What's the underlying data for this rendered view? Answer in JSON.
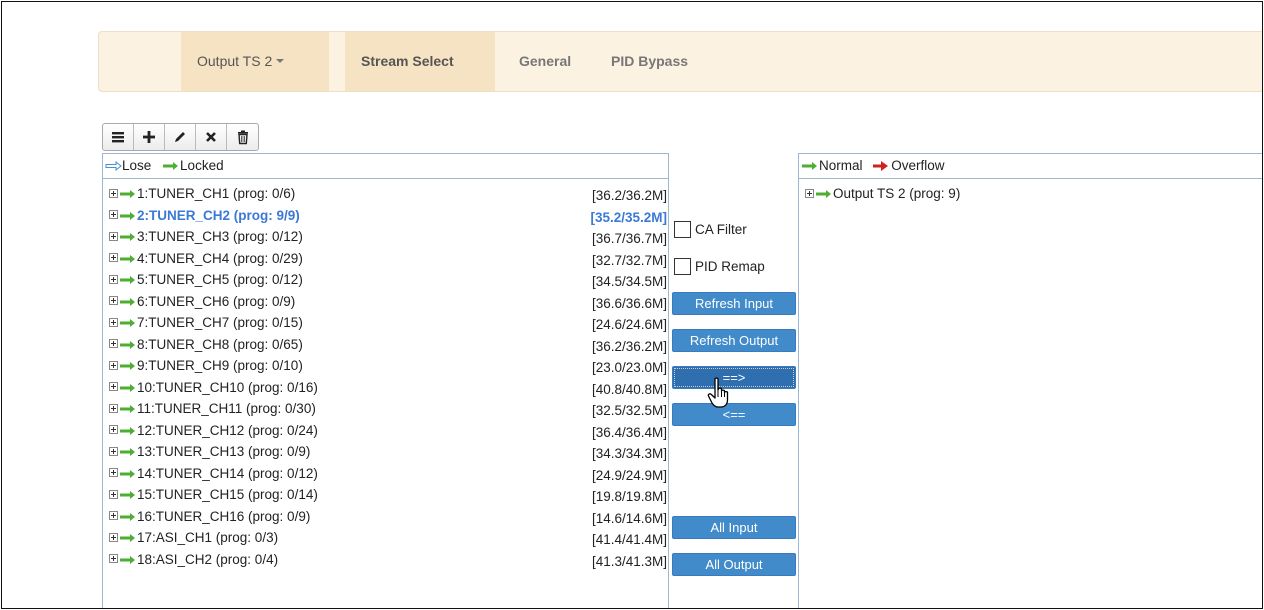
{
  "tabs": {
    "output_ts": "Output TS 2",
    "stream_select": "Stream Select",
    "general": "General",
    "pid_bypass": "PID Bypass"
  },
  "toolbar": {
    "icons": [
      "list-icon",
      "plus-icon",
      "pencil-icon",
      "close-icon",
      "trash-icon"
    ]
  },
  "input_panel": {
    "legend_lose": "Lose",
    "legend_locked": "Locked",
    "rows": [
      {
        "label": "1:TUNER_CH1 (prog: 0/6)",
        "rate": "[36.2/36.2M]"
      },
      {
        "label": "2:TUNER_CH2 (prog: 9/9)",
        "rate": "[35.2/35.2M]"
      },
      {
        "label": "3:TUNER_CH3 (prog: 0/12)",
        "rate": "[36.7/36.7M]"
      },
      {
        "label": "4:TUNER_CH4 (prog: 0/29)",
        "rate": "[32.7/32.7M]"
      },
      {
        "label": "5:TUNER_CH5 (prog: 0/12)",
        "rate": "[34.5/34.5M]"
      },
      {
        "label": "6:TUNER_CH6 (prog: 0/9)",
        "rate": "[36.6/36.6M]"
      },
      {
        "label": "7:TUNER_CH7 (prog: 0/15)",
        "rate": "[24.6/24.6M]"
      },
      {
        "label": "8:TUNER_CH8 (prog: 0/65)",
        "rate": "[36.2/36.2M]"
      },
      {
        "label": "9:TUNER_CH9 (prog: 0/10)",
        "rate": "[23.0/23.0M]"
      },
      {
        "label": "10:TUNER_CH10 (prog: 0/16)",
        "rate": "[40.8/40.8M]"
      },
      {
        "label": "11:TUNER_CH11 (prog: 0/30)",
        "rate": "[32.5/32.5M]"
      },
      {
        "label": "12:TUNER_CH12 (prog: 0/24)",
        "rate": "[36.4/36.4M]"
      },
      {
        "label": "13:TUNER_CH13 (prog: 0/9)",
        "rate": "[34.3/34.3M]"
      },
      {
        "label": "14:TUNER_CH14 (prog: 0/12)",
        "rate": "[24.9/24.9M]"
      },
      {
        "label": "15:TUNER_CH15 (prog: 0/14)",
        "rate": "[19.8/19.8M]"
      },
      {
        "label": "16:TUNER_CH16 (prog: 0/9)",
        "rate": "[14.6/14.6M]"
      },
      {
        "label": "17:ASI_CH1 (prog: 0/3)",
        "rate": "[41.4/41.4M]"
      },
      {
        "label": "18:ASI_CH2 (prog: 0/4)",
        "rate": "[41.3/41.3M]"
      }
    ]
  },
  "controls": {
    "ca_filter": "CA Filter",
    "pid_remap": "PID Remap",
    "refresh_input": "Refresh Input",
    "refresh_output": "Refresh Output",
    "move_right": "==>",
    "move_left": "<==",
    "all_input": "All Input",
    "all_output": "All Output"
  },
  "output_panel": {
    "legend_normal": "Normal",
    "legend_overflow": "Overflow",
    "rows": [
      {
        "label": "Output TS 2 (prog: 9)"
      }
    ]
  },
  "colors": {
    "accent_blue": "#428bca",
    "selected_text": "#3a79d6",
    "arrow_green": "#4caf32",
    "arrow_red": "#d02020",
    "tab_bar_bg": "#fcf2e2"
  }
}
